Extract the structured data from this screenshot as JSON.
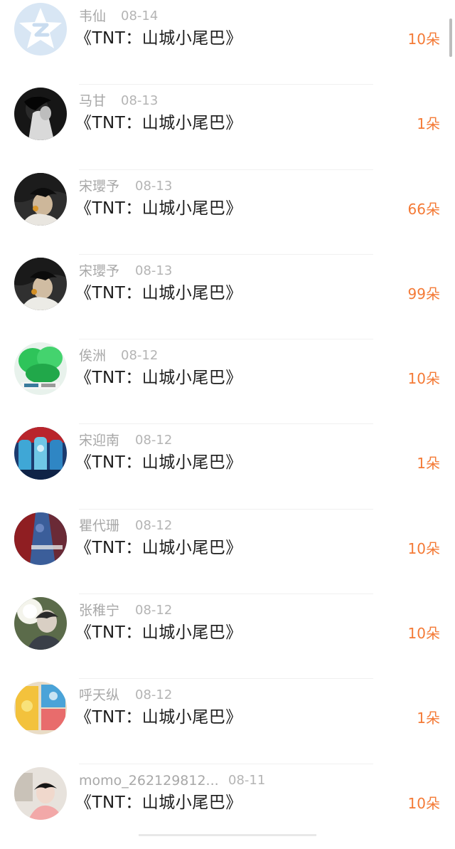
{
  "gifts": [
    {
      "user": "韦仙",
      "date": "08-14",
      "work": "《TNT：山城小尾巴》",
      "count": "10朵",
      "avatar": "qq-default-avatar"
    },
    {
      "user": "马甘",
      "date": "08-13",
      "work": "《TNT：山城小尾巴》",
      "count": "1朵",
      "avatar": "user-photo-avatar"
    },
    {
      "user": "宋瓔予",
      "date": "08-13",
      "work": "《TNT：山城小尾巴》",
      "count": "66朵",
      "avatar": "user-photo-avatar"
    },
    {
      "user": "宋瓔予",
      "date": "08-13",
      "work": "《TNT：山城小尾巴》",
      "count": "99朵",
      "avatar": "user-photo-avatar"
    },
    {
      "user": "俟洲",
      "date": "08-12",
      "work": "《TNT：山城小尾巴》",
      "count": "10朵",
      "avatar": "user-photo-avatar"
    },
    {
      "user": "宋迎南",
      "date": "08-12",
      "work": "《TNT：山城小尾巴》",
      "count": "1朵",
      "avatar": "user-photo-avatar"
    },
    {
      "user": "瞿代珊",
      "date": "08-12",
      "work": "《TNT：山城小尾巴》",
      "count": "10朵",
      "avatar": "user-photo-avatar"
    },
    {
      "user": "张稚宁",
      "date": "08-12",
      "work": "《TNT：山城小尾巴》",
      "count": "10朵",
      "avatar": "user-photo-avatar"
    },
    {
      "user": "呼天纵",
      "date": "08-12",
      "work": "《TNT：山城小尾巴》",
      "count": "1朵",
      "avatar": "user-photo-avatar"
    },
    {
      "user": "momo_262129812...",
      "date": "08-11",
      "work": "《TNT：山城小尾巴》",
      "count": "10朵",
      "avatar": "user-photo-avatar"
    }
  ],
  "colors": {
    "count_accent": "#f47a36",
    "name_gray": "#a8a8a8",
    "title_dark": "#1c1c1c"
  }
}
